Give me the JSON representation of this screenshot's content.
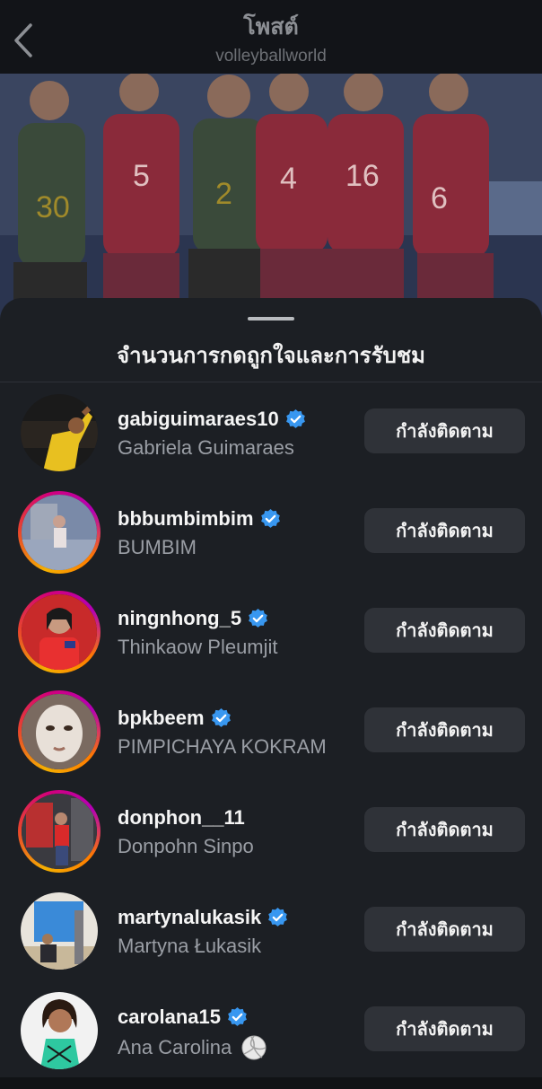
{
  "header": {
    "title": "โพสต์",
    "subtitle": "volleyballworld",
    "back_icon": "chevron-left-icon"
  },
  "photo": {
    "description_icon": "team-photo",
    "jersey_numbers": [
      "30",
      "5",
      "2",
      "4",
      "16",
      "6"
    ]
  },
  "sheet": {
    "title": "จำนวนการกดถูกใจและการรับชม"
  },
  "users": [
    {
      "username": "gabiguimaraes10",
      "full_name": "Gabriela Guimaraes",
      "verified": true,
      "story_ring": false,
      "button": "กำลังติดตาม"
    },
    {
      "username": "bbbumbimbim",
      "full_name": "BUMBIM",
      "verified": true,
      "story_ring": true,
      "button": "กำลังติดตาม"
    },
    {
      "username": "ningnhong_5",
      "full_name": "Thinkaow Pleumjit",
      "verified": true,
      "story_ring": true,
      "button": "กำลังติดตาม"
    },
    {
      "username": "bpkbeem",
      "full_name": "PIMPICHAYA KOKRAM",
      "verified": true,
      "story_ring": true,
      "button": "กำลังติดตาม"
    },
    {
      "username": "donphon__11",
      "full_name": "Donpohn Sinpo",
      "verified": false,
      "story_ring": true,
      "button": "กำลังติดตาม"
    },
    {
      "username": "martynalukasik",
      "full_name": "Martyna Łukasik",
      "verified": true,
      "story_ring": false,
      "button": "กำลังติดตาม"
    },
    {
      "username": "carolana15",
      "full_name": "Ana Carolina",
      "verified": true,
      "story_ring": false,
      "button": "กำลังติดตาม",
      "emoji_icon": "volleyball-icon"
    }
  ],
  "colors": {
    "background": "#1c1f24",
    "button": "#2f3238",
    "verified": "#3897f0",
    "secondary_text": "#9a9ea5"
  }
}
